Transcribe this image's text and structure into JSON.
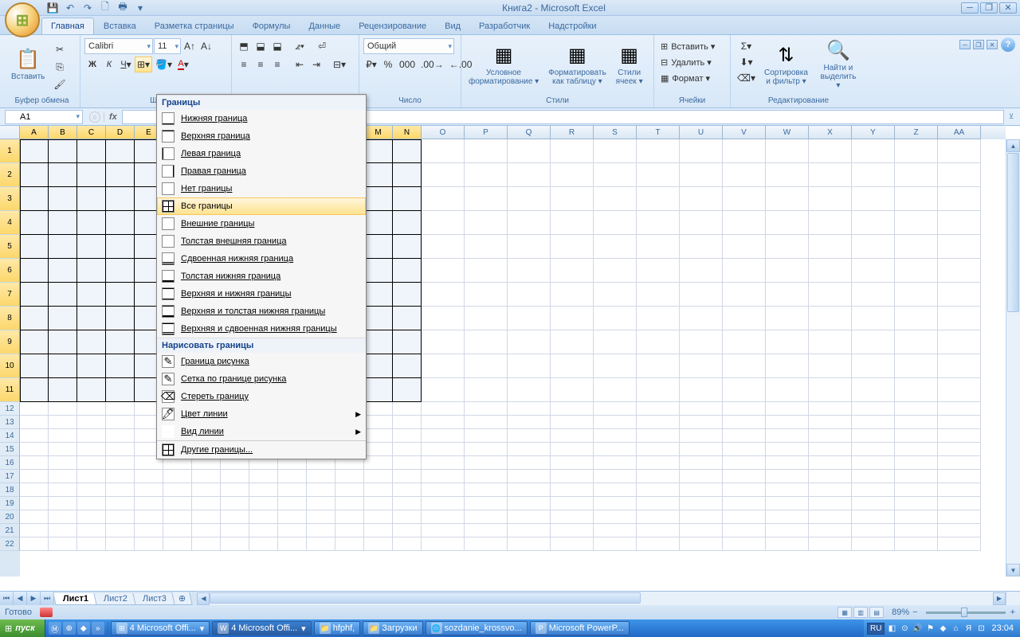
{
  "app": {
    "title": "Книга2 - Microsoft Excel"
  },
  "tabs": {
    "home": "Главная",
    "insert": "Вставка",
    "layout": "Разметка страницы",
    "formulas": "Формулы",
    "data": "Данные",
    "review": "Рецензирование",
    "view": "Вид",
    "developer": "Разработчик",
    "addins": "Надстройки"
  },
  "ribbon": {
    "clipboard": {
      "label": "Буфер обмена",
      "paste": "Вставить"
    },
    "font": {
      "label": "Шр",
      "name": "Calibri",
      "size": "11"
    },
    "alignment": {
      "label": ""
    },
    "number": {
      "label": "Число",
      "format": "Общий"
    },
    "styles": {
      "label": "Стили",
      "cond": "Условное\nформатирование ▾",
      "table": "Форматировать\nкак таблицу ▾",
      "cell": "Стили\nячеек ▾"
    },
    "cells": {
      "label": "Ячейки",
      "insert": "Вставить ▾",
      "delete": "Удалить ▾",
      "format": "Формат ▾"
    },
    "editing": {
      "label": "Редактирование",
      "sort": "Сортировка\nи фильтр ▾",
      "find": "Найти и\nвыделить ▾"
    }
  },
  "name_box": "A1",
  "borders_menu": {
    "header1": "Границы",
    "items": [
      "Нижняя граница",
      "Верхняя граница",
      "Левая граница",
      "Правая граница",
      "Нет границы",
      "Все границы",
      "Внешние границы",
      "Толстая внешняя граница",
      "Сдвоенная нижняя граница",
      "Толстая нижняя граница",
      "Верхняя и нижняя границы",
      "Верхняя и толстая нижняя границы",
      "Верхняя и сдвоенная нижняя границы"
    ],
    "header2": "Нарисовать границы",
    "draw_items": [
      "Граница рисунка",
      "Сетка по границе рисунка",
      "Стереть границу",
      "Цвет линии",
      "Вид линии"
    ],
    "more": "Другие границы..."
  },
  "columns": [
    "A",
    "B",
    "C",
    "D",
    "E",
    "",
    "",
    "",
    "",
    "",
    "",
    "",
    "M",
    "N",
    "O",
    "P",
    "Q",
    "R",
    "S",
    "T",
    "U",
    "V",
    "W",
    "X",
    "Y",
    "Z",
    "AA"
  ],
  "rows": [
    "1",
    "2",
    "3",
    "4",
    "5",
    "6",
    "7",
    "8",
    "9",
    "10",
    "11",
    "12",
    "13",
    "14",
    "15",
    "16",
    "17",
    "18",
    "19",
    "20",
    "21",
    "22"
  ],
  "sheets": {
    "s1": "Лист1",
    "s2": "Лист2",
    "s3": "Лист3"
  },
  "status": {
    "ready": "Готово",
    "zoom": "89%"
  },
  "taskbar": {
    "start": "пуск",
    "tasks": [
      "4 Microsoft Offi...",
      "4 Microsoft Offi...",
      "hfphf,",
      "Загрузки",
      "sozdanie_krossvo...",
      "Microsoft PowerP..."
    ],
    "lang": "RU",
    "time": "23:04"
  }
}
